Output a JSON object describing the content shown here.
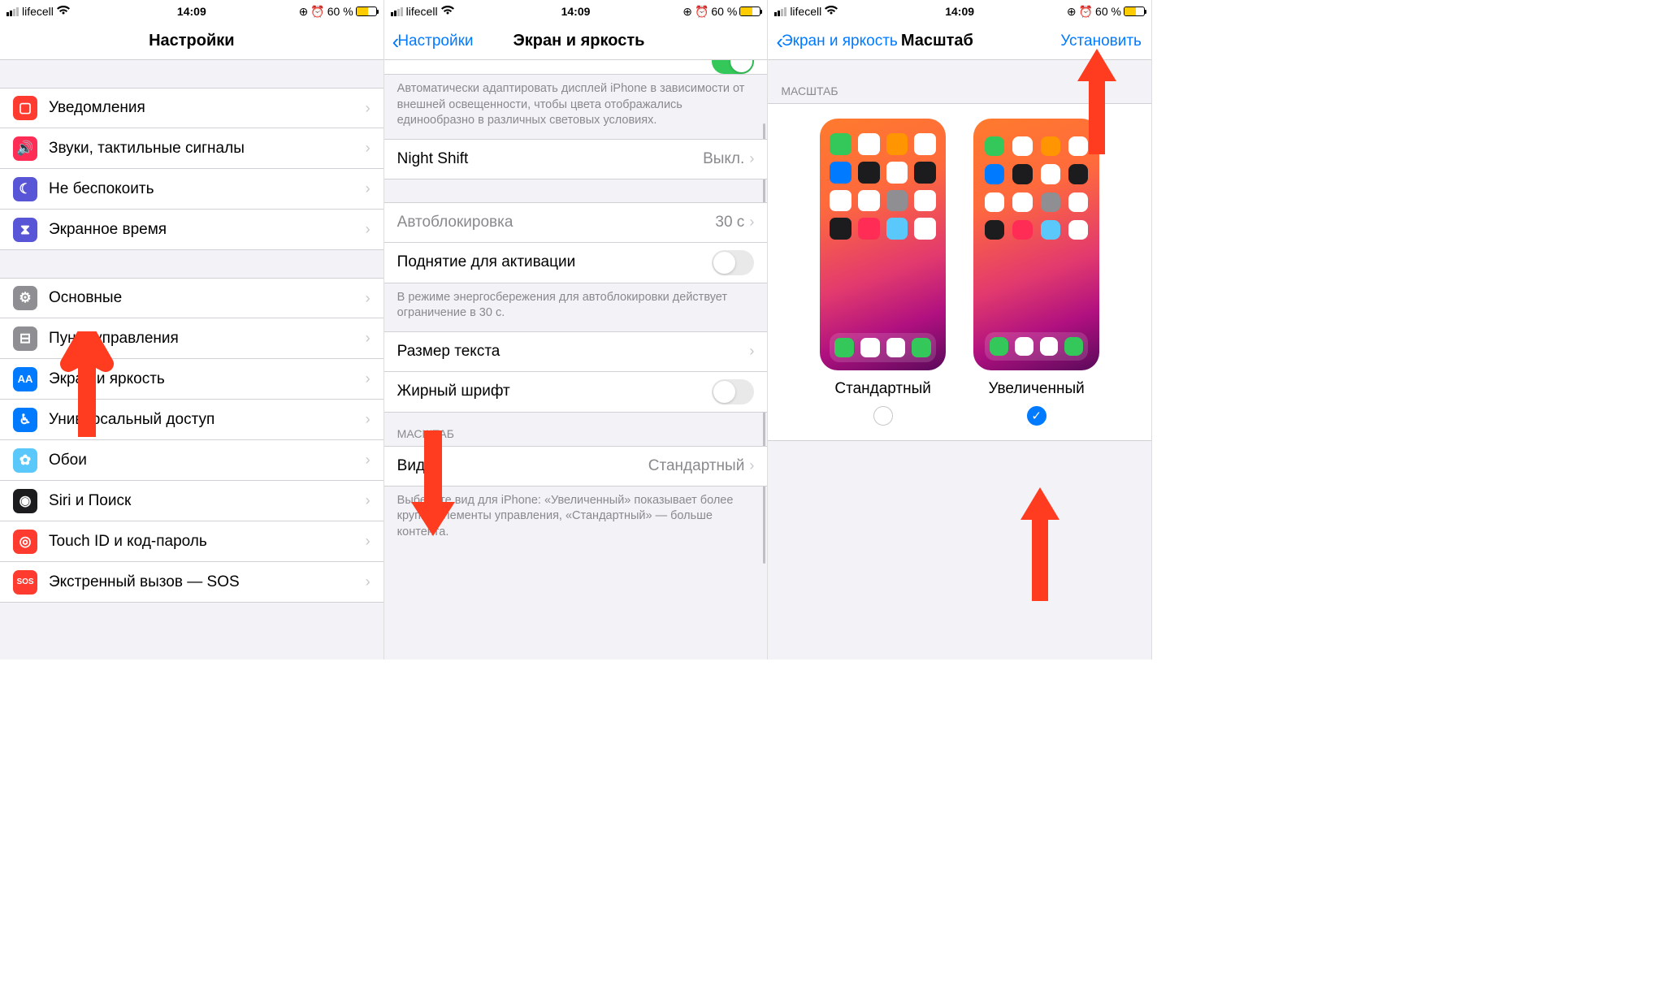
{
  "status": {
    "carrier": "lifecell",
    "time": "14:09",
    "battery": "60 %"
  },
  "panel1": {
    "title": "Настройки",
    "rows": {
      "notifications": "Уведомления",
      "sounds": "Звуки, тактильные сигналы",
      "dnd": "Не беспокоить",
      "screentime": "Экранное время",
      "general": "Основные",
      "control": "Пункт управления",
      "display": "Экран и яркость",
      "accessibility": "Универсальный доступ",
      "wallpaper": "Обои",
      "siri": "Siri и Поиск",
      "touchid": "Touch ID и код-пароль",
      "sos": "Экстренный вызов — SOS"
    }
  },
  "panel2": {
    "back": "Настройки",
    "title": "Экран и яркость",
    "auto_desc": "Автоматически адаптировать дисплей iPhone в зависимости от внешней освещенности, чтобы цвета отображались единообразно в различных световых условиях.",
    "nightshift_label": "Night Shift",
    "nightshift_value": "Выкл.",
    "autolock_label": "Автоблокировка",
    "autolock_value": "30 с",
    "raise_label": "Поднятие для активации",
    "powersave_note": "В режиме энергосбережения для автоблокировки действует ограничение в 30 с.",
    "textsize_label": "Размер текста",
    "bold_label": "Жирный шрифт",
    "zoom_header": "МАСШТАБ",
    "view_label": "Вид",
    "view_value": "Стандартный",
    "view_footer": "Выберите вид для iPhone: «Увеличенный» показывает более крупно элементы управления, «Стандартный» — больше контента."
  },
  "panel3": {
    "back": "Экран и яркость",
    "title": "Масштаб",
    "action": "Установить",
    "section": "МАСШТАБ",
    "standard": "Стандартный",
    "zoomed": "Увеличенный"
  }
}
